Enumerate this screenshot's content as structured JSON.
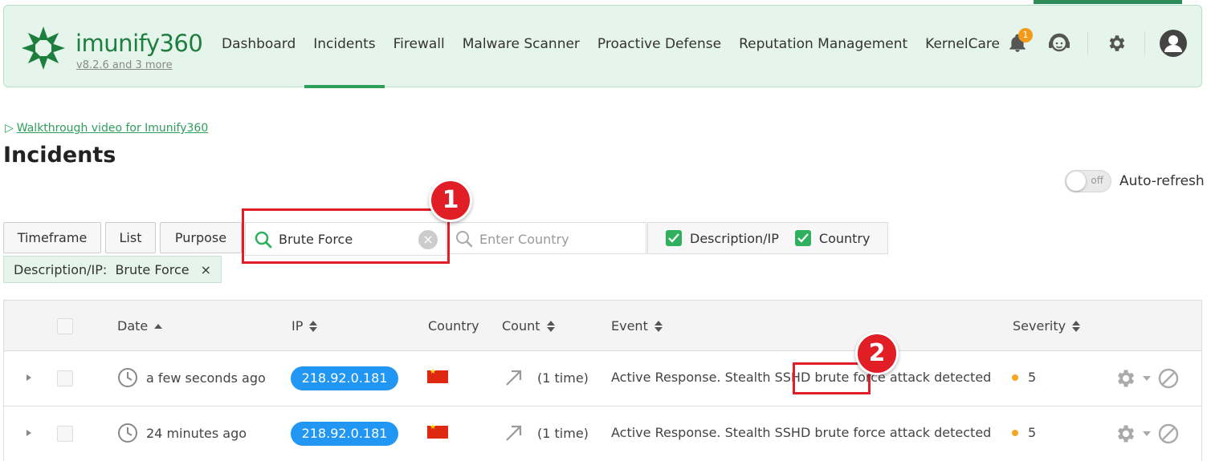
{
  "header": {
    "brand": "imunify360",
    "version": "v8.2.6 and 3 more",
    "nav": [
      {
        "label": "Dashboard"
      },
      {
        "label": "Incidents"
      },
      {
        "label": "Firewall"
      },
      {
        "label": "Malware Scanner"
      },
      {
        "label": "Proactive Defense"
      },
      {
        "label": "Reputation Management"
      },
      {
        "label": "KernelCare"
      }
    ],
    "active_nav": "Incidents",
    "notification_count": "1",
    "colors": {
      "accent": "#2e9e5b",
      "header_bg": "#e6f5ec",
      "badge": "#f29b19"
    }
  },
  "walkthrough": {
    "icon": "play-outline-icon",
    "label": "Walkthrough video for Imunify360"
  },
  "page_title": "Incidents",
  "auto_refresh": {
    "label": "Auto-refresh",
    "state_text": "off"
  },
  "filters": {
    "timeframe_label": "Timeframe",
    "list_label": "List",
    "purpose_label": "Purpose",
    "search_value": "Brute Force",
    "country_placeholder": "Enter Country",
    "checkboxes": [
      {
        "label": "Description/IP",
        "checked": true
      },
      {
        "label": "Country",
        "checked": true
      }
    ],
    "chip_label": "Description/IP:  Brute Force",
    "chip_close": "×"
  },
  "annotations": {
    "one": "1",
    "two": "2",
    "color": "#e11d26"
  },
  "table": {
    "columns": [
      {
        "label": "Date"
      },
      {
        "label": "IP"
      },
      {
        "label": "Country"
      },
      {
        "label": "Count"
      },
      {
        "label": "Event"
      },
      {
        "label": "Severity"
      }
    ],
    "rows": [
      {
        "date": "a few seconds ago",
        "ip": "218.92.0.181",
        "country_flag": "china-flag",
        "count": "(1 time)",
        "event_pre": "Active Response. Stealth SSHD ",
        "event_hl": "brute force",
        "event_post": " attack detected",
        "severity": "5"
      },
      {
        "date": "24 minutes ago",
        "ip": "218.92.0.181",
        "country_flag": "china-flag",
        "count": "(1 time)",
        "event_pre": "Active Response. Stealth SSHD ",
        "event_hl": "brute force",
        "event_post": " attack detected",
        "severity": "5"
      }
    ]
  }
}
